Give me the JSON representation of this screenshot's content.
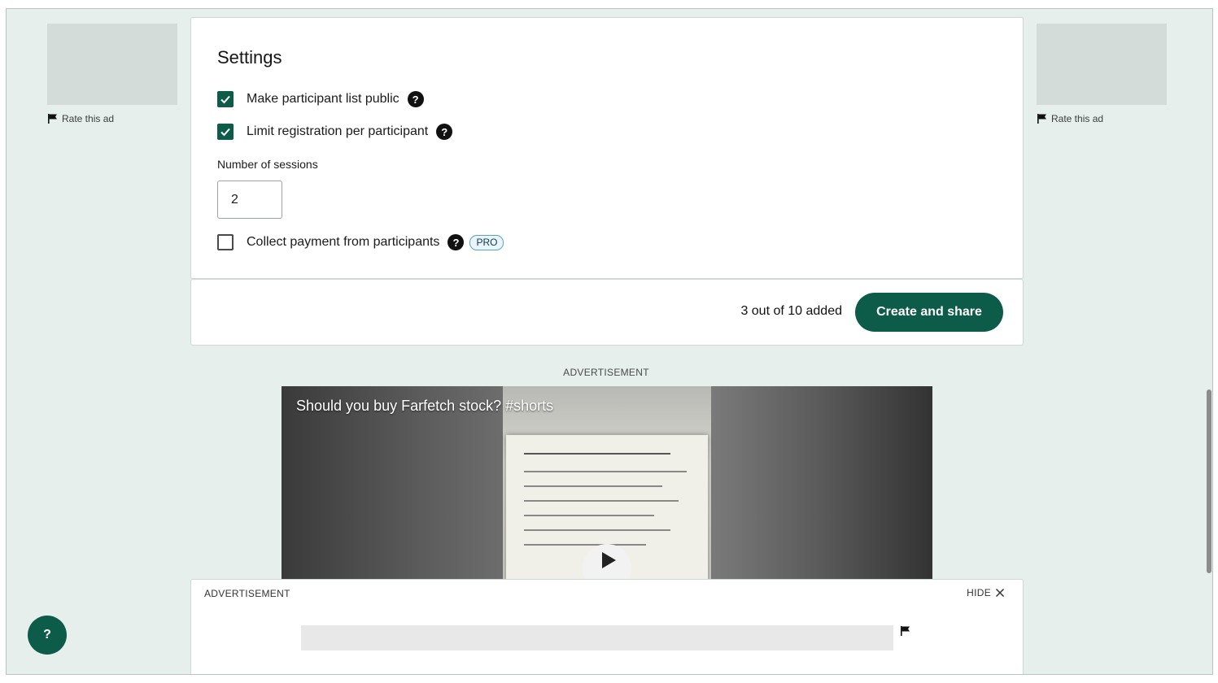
{
  "side_ads": {
    "left": {
      "rate_label": "Rate this ad"
    },
    "right": {
      "rate_label": "Rate this ad"
    }
  },
  "settings": {
    "title": "Settings",
    "options": [
      {
        "label": "Make participant list public",
        "checked": true,
        "help": "?"
      },
      {
        "label": "Limit registration per participant",
        "checked": true,
        "help": "?"
      }
    ],
    "sessions": {
      "label": "Number of sessions",
      "value": "2"
    },
    "payment": {
      "label": "Collect payment from participants",
      "checked": false,
      "help": "?",
      "badge": "PRO"
    }
  },
  "footer": {
    "count_text": "3 out of 10 added",
    "create_label": "Create and share"
  },
  "video_ad": {
    "caption": "ADVERTISEMENT",
    "title": "Should you buy Farfetch stock? #shorts"
  },
  "bottom_ad": {
    "caption": "ADVERTISEMENT",
    "hide_label": "HIDE"
  },
  "help_fab": {
    "label": "?"
  },
  "colors": {
    "brand": "#0d5b49",
    "background": "#e6efec",
    "pro_badge_border": "#5aa2c7"
  }
}
